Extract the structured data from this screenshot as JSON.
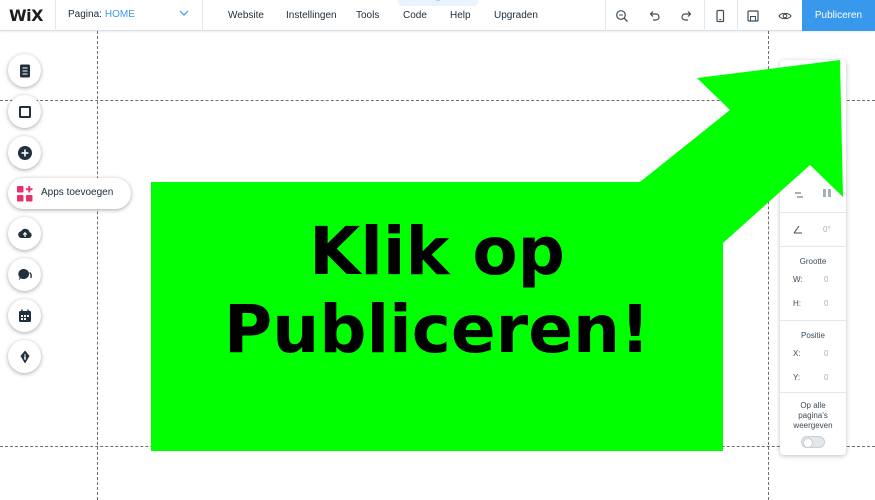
{
  "topbar": {
    "logo": "WiX",
    "page_label": "Pagina:",
    "page_value": "HOME",
    "menu": [
      {
        "id": "website",
        "label": "Website"
      },
      {
        "id": "instellingen",
        "label": "Instellingen"
      },
      {
        "id": "tools",
        "label": "Tools"
      },
      {
        "id": "code",
        "label": "Code"
      },
      {
        "id": "help",
        "label": "Help"
      },
      {
        "id": "upgraden",
        "label": "Upgraden"
      }
    ],
    "icons": [
      "zoom-icon",
      "undo-icon",
      "redo-icon",
      "mobile-view-icon",
      "save-icon",
      "preview-eye-icon"
    ],
    "publish_label": "Publiceren"
  },
  "left_toolbar": {
    "apps_label": "Apps toevoegen",
    "icons": [
      "pages-icon",
      "background-icon",
      "add-icon",
      "apps-icon",
      "upload-icon",
      "chat-icon",
      "bookings-icon",
      "blog-pen-icon"
    ]
  },
  "right_panel": {
    "close": "×",
    "rotation_value": "0°",
    "size_header": "Grootte",
    "width_label": "W:",
    "width_value": "0",
    "height_label": "H:",
    "height_value": "0",
    "position_header": "Positie",
    "x_label": "X:",
    "x_value": "0",
    "y_label": "Y:",
    "y_value": "0",
    "show_all_line1": "Op alle",
    "show_all_line2": "pagina's",
    "show_all_line3": "weergeven",
    "show_all_on": false
  },
  "overlay": {
    "line1": "Klik op",
    "line2": "Publiceren!",
    "color": "#00ff00"
  },
  "colors": {
    "accent": "#3899ec",
    "text": "#20303c"
  }
}
